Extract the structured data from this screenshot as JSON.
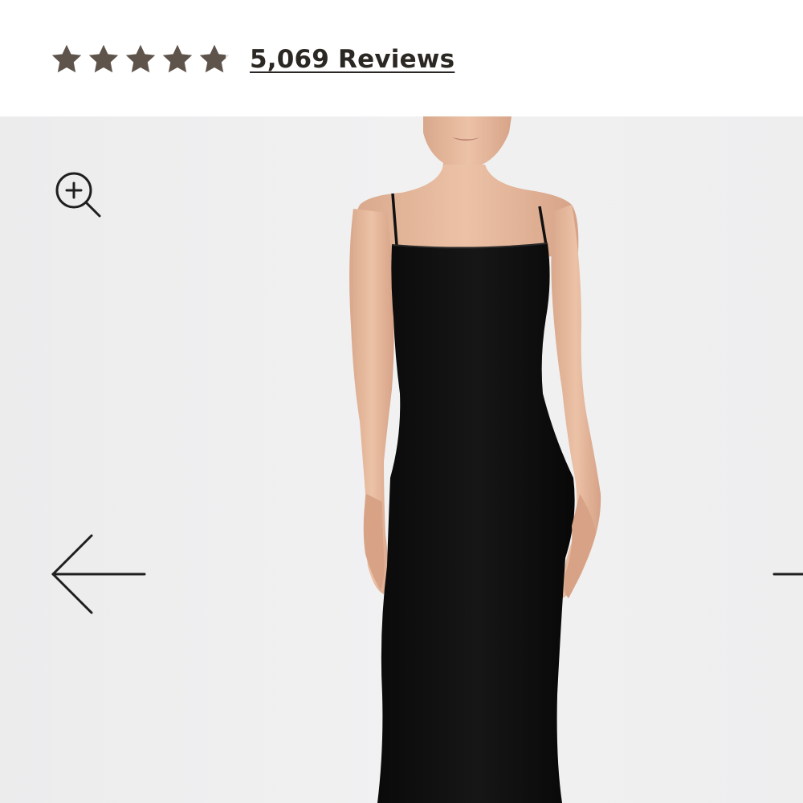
{
  "rating": {
    "stars_filled": 4.8,
    "stars_total": 5,
    "star_color": "#5e544c",
    "reviews_label": "5,069 Reviews"
  },
  "gallery": {
    "background_color": "#efeff0",
    "product_image": "model-wearing-black-slip-dress",
    "controls": {
      "zoom_icon": "zoom-in-icon",
      "prev_icon": "arrow-left-icon",
      "next_icon": "arrow-right-icon"
    }
  }
}
